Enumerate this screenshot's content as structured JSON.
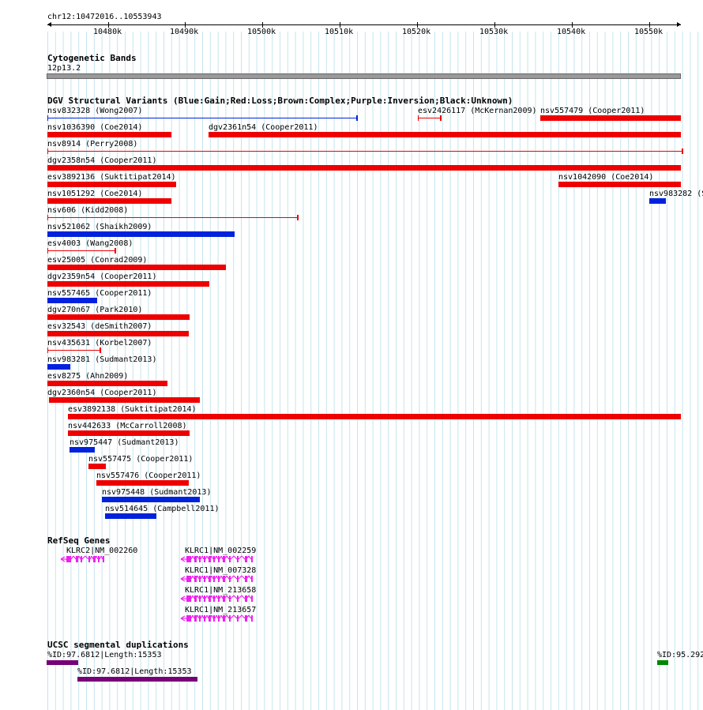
{
  "ruler": {
    "title": "chr12:10472016..10553943",
    "ticks": [
      "10480k",
      "10490k",
      "10500k",
      "10510k",
      "10520k",
      "10530k",
      "10540k",
      "10550k"
    ]
  },
  "cytobands": {
    "header": "Cytogenetic Bands",
    "band": "12p13.2"
  },
  "dgv": {
    "header": "DGV Structural Variants (Blue:Gain;Red:Loss;Brown:Complex;Purple:Inversion;Black:Unknown)",
    "colors": {
      "gain": "#0022dd",
      "loss": "#ee0000"
    },
    "variants": [
      {
        "label": "nsv832328 (Wong2007)",
        "type": "gain",
        "style": "thin"
      },
      {
        "label": "esv2426117 (McKernan2009)",
        "type": "loss",
        "style": "thin"
      },
      {
        "label": "nsv557479 (Cooper2011)",
        "type": "loss",
        "style": "thick"
      },
      {
        "label": "nsv1036390 (Coe2014)",
        "type": "loss",
        "style": "thick"
      },
      {
        "label": "dgv2361n54 (Cooper2011)",
        "type": "loss",
        "style": "thick"
      },
      {
        "label": "nsv8914 (Perry2008)",
        "type": "loss",
        "style": "thin"
      },
      {
        "label": "dgv2358n54 (Cooper2011)",
        "type": "loss",
        "style": "thick"
      },
      {
        "label": "esv3892136 (Suktitipat2014)",
        "type": "loss",
        "style": "thick"
      },
      {
        "label": "nsv1042090 (Coe2014)",
        "type": "loss",
        "style": "thick"
      },
      {
        "label": "nsv1051292 (Coe2014)",
        "type": "loss",
        "style": "thick"
      },
      {
        "label": "nsv983282 (S",
        "type": "gain",
        "style": "thick"
      },
      {
        "label": "nsv606 (Kidd2008)",
        "type": "loss",
        "style": "thin"
      },
      {
        "label": "nsv521062 (Shaikh2009)",
        "type": "gain",
        "style": "thick"
      },
      {
        "label": "esv4003 (Wang2008)",
        "type": "loss",
        "style": "thin"
      },
      {
        "label": "esv25005 (Conrad2009)",
        "type": "loss",
        "style": "thick"
      },
      {
        "label": "dgv2359n54 (Cooper2011)",
        "type": "loss",
        "style": "thick"
      },
      {
        "label": "nsv557465 (Cooper2011)",
        "type": "gain",
        "style": "thick"
      },
      {
        "label": "dgv270n67 (Park2010)",
        "type": "loss",
        "style": "thick"
      },
      {
        "label": "esv32543 (deSmith2007)",
        "type": "loss",
        "style": "thick"
      },
      {
        "label": "nsv435631 (Korbel2007)",
        "type": "loss",
        "style": "thin"
      },
      {
        "label": "nsv983281 (Sudmant2013)",
        "type": "gain",
        "style": "thick"
      },
      {
        "label": "esv8275 (Ahn2009)",
        "type": "loss",
        "style": "thick"
      },
      {
        "label": "dgv2360n54 (Cooper2011)",
        "type": "loss",
        "style": "thick"
      },
      {
        "label": "esv3892138 (Suktitipat2014)",
        "type": "loss",
        "style": "thick"
      },
      {
        "label": "nsv442633 (McCarroll2008)",
        "type": "loss",
        "style": "thick"
      },
      {
        "label": "nsv975447 (Sudmant2013)",
        "type": "gain",
        "style": "thick"
      },
      {
        "label": "nsv557475 (Cooper2011)",
        "type": "loss",
        "style": "thick"
      },
      {
        "label": "nsv557476 (Cooper2011)",
        "type": "loss",
        "style": "thick"
      },
      {
        "label": "nsv975448 (Sudmant2013)",
        "type": "gain",
        "style": "thick"
      },
      {
        "label": "nsv514645 (Campbell2011)",
        "type": "gain",
        "style": "thick"
      }
    ]
  },
  "refseq": {
    "header": "RefSeq Genes",
    "color": "#ee22ee",
    "genes": [
      "KLRC2|NM_002260",
      "KLRC1|NM_002259",
      "KLRC1|NM_007328",
      "KLRC1|NM_213658",
      "KLRC1|NM_213657"
    ]
  },
  "segdups": {
    "header": "UCSC segmental duplications",
    "items": [
      {
        "label": "%ID:97.6812|Length:15353",
        "color": "#770077"
      },
      {
        "label": "%ID:97.6812|Length:15353",
        "color": "#770077"
      },
      {
        "label": "%ID:95.292",
        "color": "#008800"
      }
    ]
  }
}
